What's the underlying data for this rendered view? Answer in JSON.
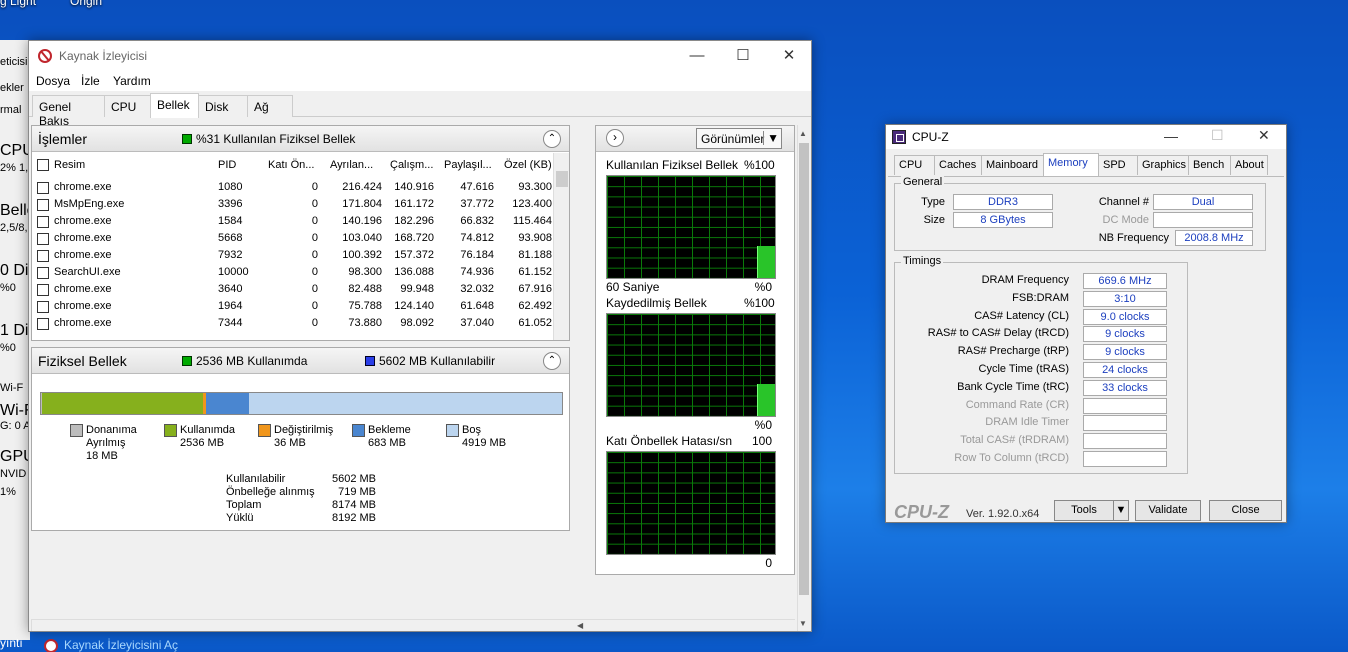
{
  "desktop": {
    "icon1_label": "g Light",
    "icon2_label": "Origin"
  },
  "bg_window": {
    "lines": [
      "eticisi",
      "ekler",
      "rmal",
      "CPU",
      "2% 1,",
      "Belle",
      "2,5/8,",
      "0 Di",
      "%0",
      "1 Di",
      "%0",
      "Wi-F",
      "Wi-Fi",
      "G: 0 A",
      "GPU",
      "NVID",
      "1%"
    ]
  },
  "taskbar_hint": {
    "left": "yıntı",
    "link": "Kaynak İzleyicisini Aç"
  },
  "rm": {
    "title": "Kaynak İzleyicisi",
    "menu": [
      "Dosya",
      "İzle",
      "Yardım"
    ],
    "tabs": [
      "Genel Bakış",
      "CPU",
      "Bellek",
      "Disk",
      "Ağ"
    ],
    "active_tab": "Bellek",
    "proc": {
      "header": "İşlemler",
      "summary": "%31 Kullanılan Fiziksel Bellek",
      "columns": [
        "Resim",
        "PID",
        "Katı Ön...",
        "Ayrılan...",
        "Çalışm...",
        "Paylaşıl...",
        "Özel (KB)"
      ],
      "rows": [
        [
          "chrome.exe",
          "1080",
          "0",
          "216.424",
          "140.916",
          "47.616",
          "93.300"
        ],
        [
          "MsMpEng.exe",
          "3396",
          "0",
          "171.804",
          "161.172",
          "37.772",
          "123.400"
        ],
        [
          "chrome.exe",
          "1584",
          "0",
          "140.196",
          "182.296",
          "66.832",
          "115.464"
        ],
        [
          "chrome.exe",
          "5668",
          "0",
          "103.040",
          "168.720",
          "74.812",
          "93.908"
        ],
        [
          "chrome.exe",
          "7932",
          "0",
          "100.392",
          "157.372",
          "76.184",
          "81.188"
        ],
        [
          "SearchUI.exe",
          "10000",
          "0",
          "98.300",
          "136.088",
          "74.936",
          "61.152"
        ],
        [
          "chrome.exe",
          "3640",
          "0",
          "82.488",
          "99.948",
          "32.032",
          "67.916"
        ],
        [
          "chrome.exe",
          "1964",
          "0",
          "75.788",
          "124.140",
          "61.648",
          "62.492"
        ],
        [
          "chrome.exe",
          "7344",
          "0",
          "73.880",
          "98.092",
          "37.040",
          "61.052"
        ]
      ]
    },
    "phys": {
      "header": "Fiziksel Bellek",
      "in_use_label": "2536 MB Kullanımda",
      "available_label": "5602 MB Kullanılabilir",
      "bar": {
        "hardware_mb": 18,
        "in_use_mb": 2536,
        "modified_mb": 36,
        "standby_mb": 683,
        "free_mb": 4919,
        "total_mb": 8192
      },
      "legend": [
        {
          "name": "Donanıma Ayrılmış",
          "line1": "Donanıma",
          "line2": "Ayrılmış",
          "value": "18 MB",
          "color": "#bdbdbd"
        },
        {
          "name": "Kullanımda",
          "line1": "Kullanımda",
          "line2": "",
          "value": "2536 MB",
          "color": "#86b01d"
        },
        {
          "name": "Değiştirilmiş",
          "line1": "Değiştirilmiş",
          "line2": "",
          "value": "36 MB",
          "color": "#f0961c"
        },
        {
          "name": "Bekleme",
          "line1": "Bekleme",
          "line2": "",
          "value": "683 MB",
          "color": "#4a86d0"
        },
        {
          "name": "Boş",
          "line1": "Boş",
          "line2": "",
          "value": "4919 MB",
          "color": "#bcd5ef"
        }
      ],
      "stats": [
        [
          "Kullanılabilir",
          "5602 MB"
        ],
        [
          "Önbelleğe alınmış",
          "719 MB"
        ],
        [
          "Toplam",
          "8174 MB"
        ],
        [
          "Yüklü",
          "8192 MB"
        ]
      ]
    },
    "graphs": {
      "views_label": "Görünümler",
      "items": [
        {
          "title": "Kullanılan Fiziksel Bellek",
          "max": "%100",
          "left_bottom": "60 Saniye",
          "right_bottom": "%0",
          "level": 0.31
        },
        {
          "title": "Kaydedilmiş Bellek",
          "max": "%100",
          "left_bottom": "",
          "right_bottom": "%0",
          "level": 0.31
        },
        {
          "title": "Katı Önbellek Hatası/sn",
          "max": "100",
          "left_bottom": "",
          "right_bottom": "0",
          "level": 0.0
        }
      ]
    }
  },
  "cpuz": {
    "title": "CPU-Z",
    "tabs": [
      "CPU",
      "Caches",
      "Mainboard",
      "Memory",
      "SPD",
      "Graphics",
      "Bench",
      "About"
    ],
    "active_tab": "Memory",
    "general": {
      "title": "General",
      "type_label": "Type",
      "type": "DDR3",
      "size_label": "Size",
      "size": "8 GBytes",
      "channel_label": "Channel #",
      "channel": "Dual",
      "dc_label": "DC Mode",
      "dc": "",
      "nb_label": "NB Frequency",
      "nb": "2008.8 MHz"
    },
    "timings": {
      "title": "Timings",
      "rows": [
        {
          "label": "DRAM Frequency",
          "value": "669.6 MHz",
          "enabled": true
        },
        {
          "label": "FSB:DRAM",
          "value": "3:10",
          "enabled": true
        },
        {
          "label": "CAS# Latency (CL)",
          "value": "9.0 clocks",
          "enabled": true
        },
        {
          "label": "RAS# to CAS# Delay (tRCD)",
          "value": "9 clocks",
          "enabled": true
        },
        {
          "label": "RAS# Precharge (tRP)",
          "value": "9 clocks",
          "enabled": true
        },
        {
          "label": "Cycle Time (tRAS)",
          "value": "24 clocks",
          "enabled": true
        },
        {
          "label": "Bank Cycle Time (tRC)",
          "value": "33 clocks",
          "enabled": true
        },
        {
          "label": "Command Rate (CR)",
          "value": "",
          "enabled": false
        },
        {
          "label": "DRAM Idle Timer",
          "value": "",
          "enabled": false
        },
        {
          "label": "Total CAS# (tRDRAM)",
          "value": "",
          "enabled": false
        },
        {
          "label": "Row To Column (tRCD)",
          "value": "",
          "enabled": false
        }
      ]
    },
    "footer": {
      "brand": "CPU-Z",
      "version": "Ver. 1.92.0.x64",
      "tools": "Tools",
      "validate": "Validate",
      "close": "Close"
    }
  }
}
